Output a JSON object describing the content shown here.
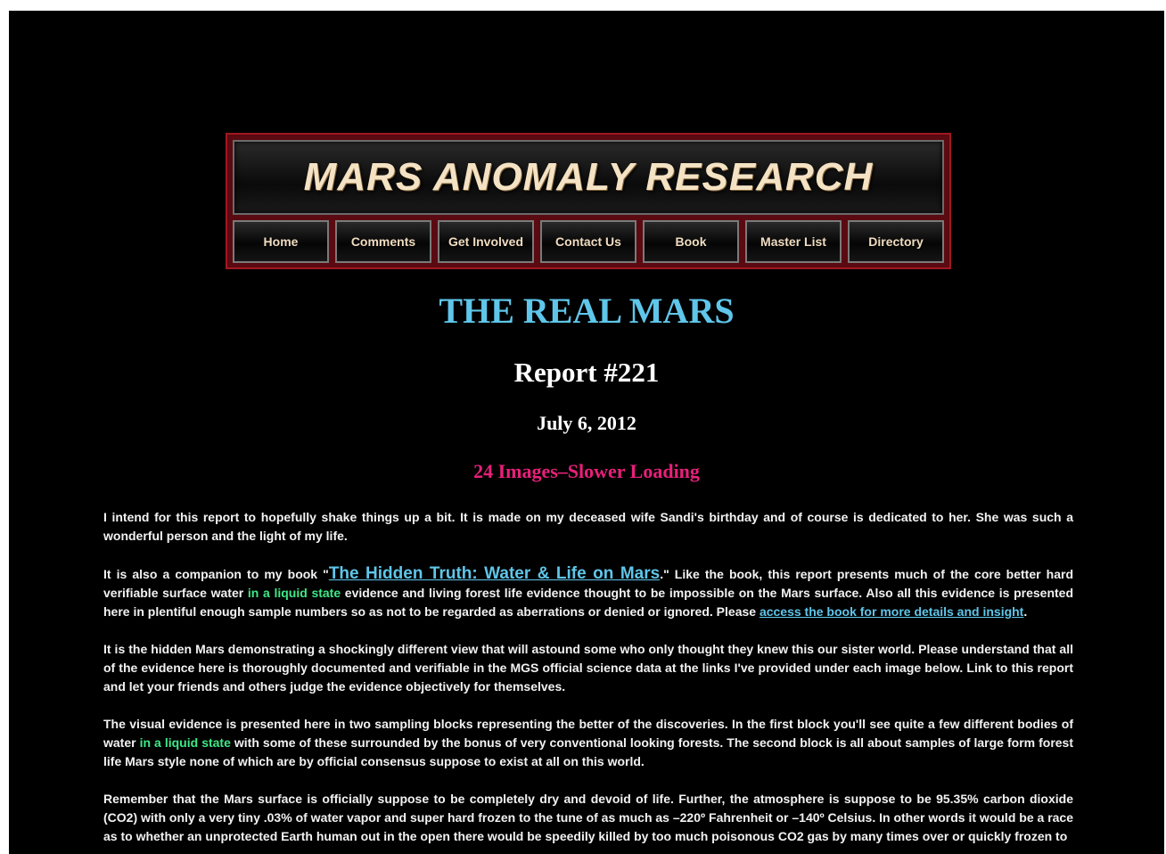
{
  "header": {
    "site_title": "MARS ANOMALY RESEARCH",
    "nav": [
      {
        "label": "Home"
      },
      {
        "label": "Comments"
      },
      {
        "label": "Get Involved"
      },
      {
        "label": "Contact Us"
      },
      {
        "label": "Book"
      },
      {
        "label": "Master List"
      },
      {
        "label": "Directory"
      }
    ]
  },
  "report": {
    "title": "THE REAL MARS",
    "number": "Report #221",
    "date": "July 6, 2012",
    "loading_note": "24 Images–Slower Loading"
  },
  "paragraphs": {
    "p1": "I intend for this report to hopefully shake things up a bit. It is made on my deceased wife Sandi's birthday and of course is dedicated to her. She was such a wonderful person and the light of my life.",
    "p2_a": "It is also a companion to my book \"",
    "p2_link": "The Hidden Truth: Water & Life on Mars",
    "p2_b": ".\" Like the book, this report presents much of the core better hard verifiable surface water ",
    "p2_green": "in a liquid state",
    "p2_c": " evidence and living forest life evidence thought to be impossible on the Mars surface. Also all this evidence is presented here in plentiful enough sample numbers so as not to be regarded as aberrations or denied or ignored. Please ",
    "p2_link2": "access the book for more details and insight",
    "p2_d": ".",
    "p3": "It is the hidden Mars demonstrating a shockingly different view that will astound some who only thought they knew this our sister world. Please understand that all of the evidence here is thoroughly documented and verifiable in the MGS official science data at the links I've provided under each image below. Link to this report and let your friends and others judge the evidence objectively for themselves.",
    "p4_a": "The visual evidence is presented here in two sampling blocks representing the better of the discoveries. In the first block you'll see quite a few different bodies of water ",
    "p4_green": "in a liquid state",
    "p4_b": " with some of these surrounded by the bonus of very conventional looking forests. The second block is all about samples of large form forest life Mars style none of which are by official consensus suppose to exist at all on this world.",
    "p5": "Remember that the Mars surface is officially suppose to be completely dry and devoid of life. Further, the atmosphere is suppose to be 95.35% carbon dioxide (CO2) with only a very tiny .03% of water vapor and super hard frozen to the tune of as much as –220º Fahrenheit or –140º Celsius. In other words it would be a race as to whether an unprotected Earth human out in the open there would be speedily killed by too much poisonous CO2 gas by many times over or quickly frozen to"
  },
  "colors": {
    "background": "#000000",
    "title_blue": "#5fc6ea",
    "loading_pink": "#e8207a",
    "liquid_green": "#3ee887",
    "banner_red": "#a01822"
  }
}
